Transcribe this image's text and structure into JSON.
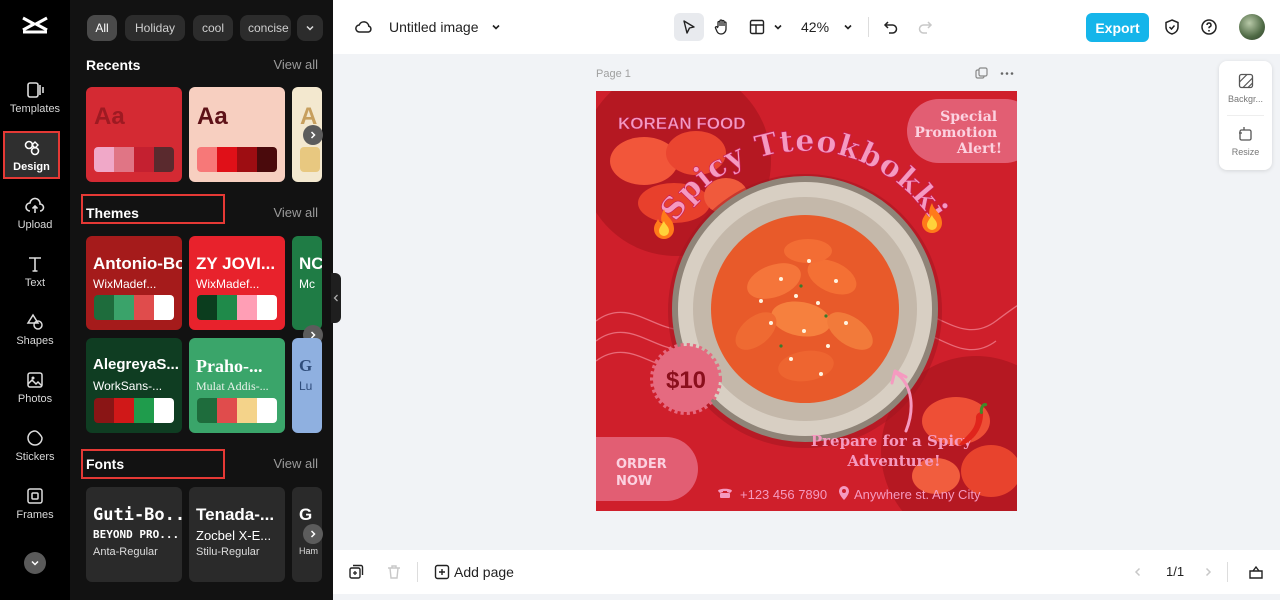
{
  "app": {
    "doc_title": "Untitled image",
    "zoom": "42%",
    "export_label": "Export"
  },
  "rail": {
    "items": [
      {
        "label": "Templates",
        "icon": "templates-icon"
      },
      {
        "label": "Design",
        "icon": "design-icon",
        "active": true
      },
      {
        "label": "Upload",
        "icon": "upload-icon"
      },
      {
        "label": "Text",
        "icon": "text-icon"
      },
      {
        "label": "Shapes",
        "icon": "shapes-icon"
      },
      {
        "label": "Photos",
        "icon": "photos-icon"
      },
      {
        "label": "Stickers",
        "icon": "stickers-icon"
      },
      {
        "label": "Frames",
        "icon": "frames-icon"
      }
    ]
  },
  "panel": {
    "chips": [
      "All",
      "Holiday",
      "cool",
      "concise"
    ],
    "recents": {
      "title": "Recents",
      "view_all": "View all",
      "cards": [
        {
          "text": "Aa",
          "bg": "#d42a33",
          "fg": "#9e1a22",
          "colors": [
            "#f0a8c8",
            "#e07585",
            "#c42030",
            "#5a2a2e"
          ]
        },
        {
          "text": "Aa",
          "bg": "#f7cfc0",
          "fg": "#5e1218",
          "colors": [
            "#f77878",
            "#e01018",
            "#9e0d12",
            "#4a0a0c"
          ]
        },
        {
          "text": "A",
          "bg": "#f3e8cf",
          "fg": "#c79f5e",
          "colors": [
            "#e8c880"
          ]
        }
      ]
    },
    "themes": {
      "title": "Themes",
      "view_all": "View all",
      "cards": [
        {
          "title": "Antonio-Bold",
          "subtitle": "WixMadef...",
          "bg": "#a51b1b",
          "fg": "#ffffff",
          "colors": [
            "#1e6c3c",
            "#3aa36a",
            "#e04c4c",
            "#ffffff"
          ]
        },
        {
          "title": "ZY JOVI...",
          "subtitle": "WixMadef...",
          "bg": "#e8222c",
          "fg": "#ffffff",
          "colors": [
            "#0b3d1e",
            "#1f8a4a",
            "#ff9eb5",
            "#ffffff"
          ]
        },
        {
          "title": "NC",
          "subtitle": "Mc",
          "bg": "#1f7c45",
          "fg": "#ffffff",
          "colors": []
        },
        {
          "title": "AlegreyaS...",
          "subtitle": "WorkSans-...",
          "bg": "#0f3d22",
          "fg": "#ffffff",
          "colors": [
            "#8a1515",
            "#d01818",
            "#1f9c4c",
            "#ffffff"
          ]
        },
        {
          "title": "Praho-...",
          "subtitle": "Mulat Addis-...",
          "bg": "#3aa56a",
          "fg": "#ffffff",
          "colors": [
            "#1e6c3c",
            "#e04c4c",
            "#f4d38a",
            "#ffffff"
          ]
        },
        {
          "title": "G",
          "subtitle": "Lu",
          "bg": "#8fb0e0",
          "fg": "#2e4c7a",
          "colors": []
        }
      ]
    },
    "fonts": {
      "title": "Fonts",
      "view_all": "View all",
      "cards": [
        {
          "l1": "Guti-Bo...",
          "l2": "BEYOND PRO...",
          "l3": "Anta-Regular"
        },
        {
          "l1": "Tenada-...",
          "l2": "Zocbel X-E...",
          "l3": "Stilu-Regular"
        },
        {
          "l1": "G",
          "l2": "",
          "l3": "Ham"
        }
      ]
    }
  },
  "canvas": {
    "page_label": "Page 1",
    "design": {
      "heading": "KOREAN FOOD",
      "arc_title": "Spicy Tteokbokki",
      "promo": [
        "Special",
        "Promotion",
        "Alert!"
      ],
      "price": "$10",
      "tagline": [
        "Prepare for a Spicy",
        "Adventure!"
      ],
      "order": [
        "ORDER",
        "NOW"
      ],
      "phone": "+123 456 7890",
      "address": "Anywhere st. Any City",
      "colors": {
        "bg": "#cf1f2b",
        "accent": "#f59ac0",
        "badge": "#e56a80"
      }
    }
  },
  "right_tools": [
    {
      "label": "Backgr...",
      "icon": "background-icon"
    },
    {
      "label": "Resize",
      "icon": "resize-icon"
    }
  ],
  "bottom": {
    "add_page": "Add page",
    "page_count": "1/1"
  }
}
